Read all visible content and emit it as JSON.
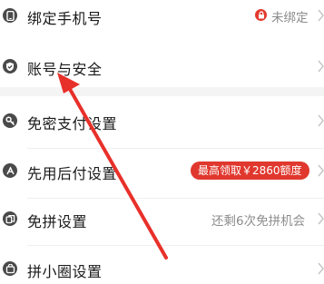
{
  "rows": [
    {
      "label": "绑定手机号",
      "right_text": "未绑定",
      "right_icon": "lock-icon",
      "icon": "phone-icon"
    },
    {
      "label": "账号与安全",
      "icon": "shield-icon"
    },
    {
      "label": "免密支付设置",
      "icon": "key-icon"
    },
    {
      "label": "先用后付设置",
      "badge": "最高领取￥2860额度",
      "icon": "pay-later-icon"
    },
    {
      "label": "免拼设置",
      "right_text": "还剩6次免拼机会",
      "icon": "group-buy-icon"
    },
    {
      "label": "拼小圈设置",
      "icon": "circle-icon"
    }
  ],
  "colors": {
    "accent": "#e0382e",
    "annotation_arrow": "#e8302a",
    "text": "#1a1a1a",
    "secondary_text": "#8c8c8c",
    "icon": "#4a4a4a",
    "section_gap": "#f4f4f4"
  }
}
